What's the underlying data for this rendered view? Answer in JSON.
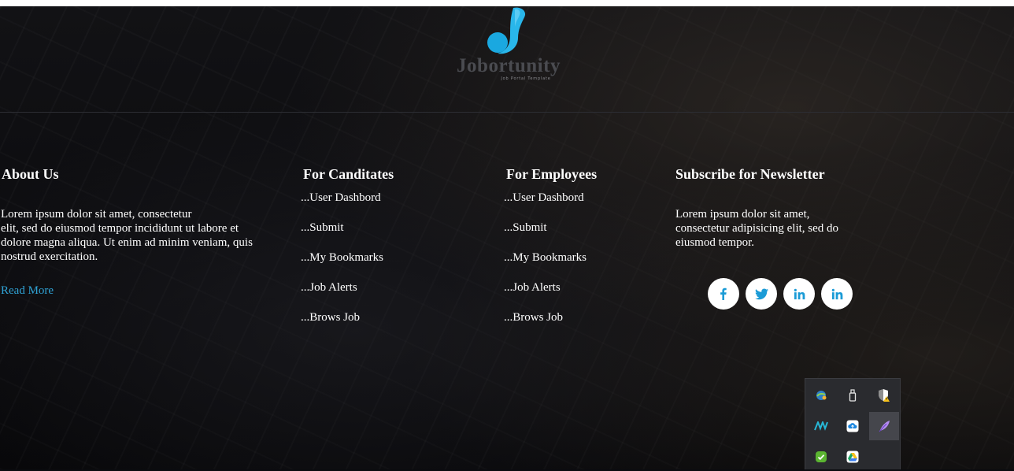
{
  "logo": {
    "name": "Jobortunity",
    "tagline": "Job Portal Template",
    "color": "#26b4e8"
  },
  "about": {
    "title": "About Us",
    "line1": "Lorem ipsum dolor sit amet, consectetur",
    "line2": "elit, sed do eiusmod tempor incididunt ut labore et",
    "line3": "dolore magna aliqua. Ut enim ad minim veniam, quis",
    "line4": "nostrud exercitation.",
    "read_more": "Read More"
  },
  "candidates": {
    "title": "For Canditates",
    "links": [
      "...User Dashbord",
      "...Submit",
      "...My Bookmarks",
      "...Job Alerts",
      "...Brows Job"
    ]
  },
  "employees": {
    "title": "For Employees",
    "links": [
      "...User Dashbord",
      "...Submit",
      "...My Bookmarks",
      "...Job Alerts",
      "...Brows Job"
    ]
  },
  "newsletter": {
    "title": "Subscribe for Newsletter",
    "line1": "Lorem ipsum dolor sit amet,",
    "line2": "consectetur adipisicing elit, sed do",
    "line3": "eiusmod tempor."
  },
  "social": [
    {
      "icon": "facebook-icon",
      "glyph": "f"
    },
    {
      "icon": "twitter-icon",
      "glyph": "t"
    },
    {
      "icon": "linkedin-icon",
      "glyph": "in"
    },
    {
      "icon": "linkedin-icon",
      "glyph": "in"
    }
  ],
  "tray": [
    {
      "icon": "network-globe-icon"
    },
    {
      "icon": "usb-drive-icon"
    },
    {
      "icon": "security-shield-warning-icon"
    },
    {
      "icon": "meridian-logo-icon"
    },
    {
      "icon": "cloud-upload-icon"
    },
    {
      "icon": "feather-app-icon"
    },
    {
      "icon": "green-check-icon"
    },
    {
      "icon": "google-drive-icon"
    }
  ],
  "colors": {
    "accent_link": "#2fa3d6",
    "social_icon": "#1b9bd6",
    "background": "#0a0b0f"
  }
}
